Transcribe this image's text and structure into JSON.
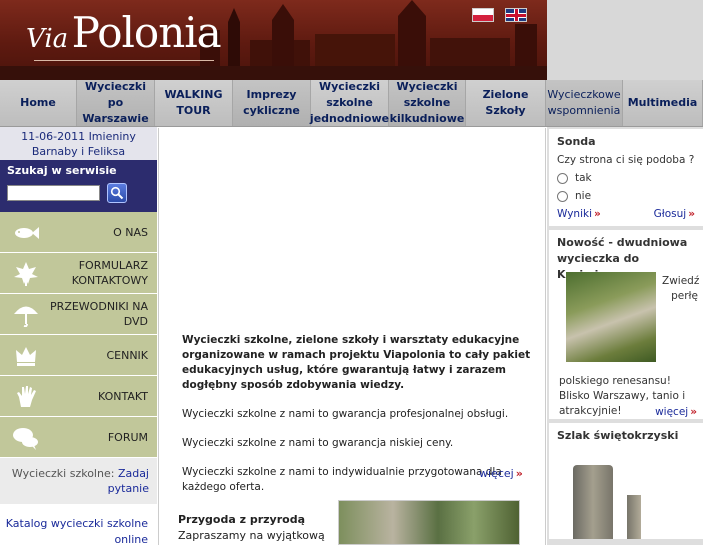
{
  "header": {
    "logo_via": "Via",
    "logo_name": "Polonia",
    "flags": [
      "pl-flag-icon",
      "en-flag-icon"
    ]
  },
  "nav": {
    "items": [
      {
        "label": "Home"
      },
      {
        "label": "Wycieczki\npo Warszawie"
      },
      {
        "label": "WALKING\nTOUR"
      },
      {
        "label": "Imprezy\ncykliczne"
      },
      {
        "label": "Wycieczki\nszkolne\njednodniowe"
      },
      {
        "label": "Wycieczki\nszkolne\nkilkudniowe"
      },
      {
        "label": "Zielone Szkoły"
      },
      {
        "label": "Wycieczkowe\nwspomnienia"
      },
      {
        "label": "Multimedia"
      }
    ]
  },
  "sidebar": {
    "date": "11-06-2011 Imieniny",
    "names": "Barnaby i Feliksa",
    "search_title": "Szukaj w serwisie",
    "search_placeholder": "",
    "menu": [
      {
        "label": "O NAS",
        "icon": "fish-icon"
      },
      {
        "label": "FORMULARZ\nKONTAKTOWY",
        "icon": "maple-leaf-icon"
      },
      {
        "label": "PRZEWODNIKI NA\nDVD",
        "icon": "umbrella-icon"
      },
      {
        "label": "CENNIK",
        "icon": "crown-icon"
      },
      {
        "label": "KONTAKT",
        "icon": "hand-icon"
      },
      {
        "label": "FORUM",
        "icon": "speech-bubbles-icon"
      }
    ],
    "school_trips_text": "Wycieczki szkolne:",
    "school_trips_link": "Zadaj pytanie",
    "catalog_line1": "Katalog wycieczki szkolne",
    "catalog_line2": "online"
  },
  "main": {
    "intro_bold": "Wycieczki szkolne, zielone szkoły i warsztaty edukacyjne organizowane w ramach projektu Viapolonia to cały pakiet edukacyjnych usług, które gwarantują łatwy i zarazem dogłębny sposób zdobywania wiedzy.",
    "line1": "Wycieczki szkolne z nami to gwarancja profesjonalnej obsługi.",
    "line2": "Wycieczki szkolne z nami to gwarancja niskiej ceny.",
    "line3": "Wycieczki szkolne z nami to indywidualnie przygotowana dla każdego oferta.",
    "more": "więcej",
    "adventure_title": "Przygoda z przyrodą",
    "adventure_text": "Zapraszamy na wyjątkową"
  },
  "right": {
    "poll_title": "Sonda",
    "poll_question": "Czy strona ci się podoba ?",
    "poll_options": [
      "tak",
      "nie"
    ],
    "results": "Wyniki",
    "vote": "Głosuj",
    "news_title": "Nowość - dwudniowa wycieczka do Kazimierza",
    "news_side": "Zwiedź perłę",
    "news_text": "polskiego renesansu! Blisko Warszawy, tanio i atrakcyjnie!",
    "news_more": "więcej",
    "trail_title": "Szlak świętokrzyski"
  },
  "colors": {
    "nav_text": "#0a1f5a",
    "search_bg": "#2c2c6e",
    "menu_bg": "#c1c79a",
    "link": "#1a2a9a",
    "accent_arrow": "#c0202a"
  }
}
